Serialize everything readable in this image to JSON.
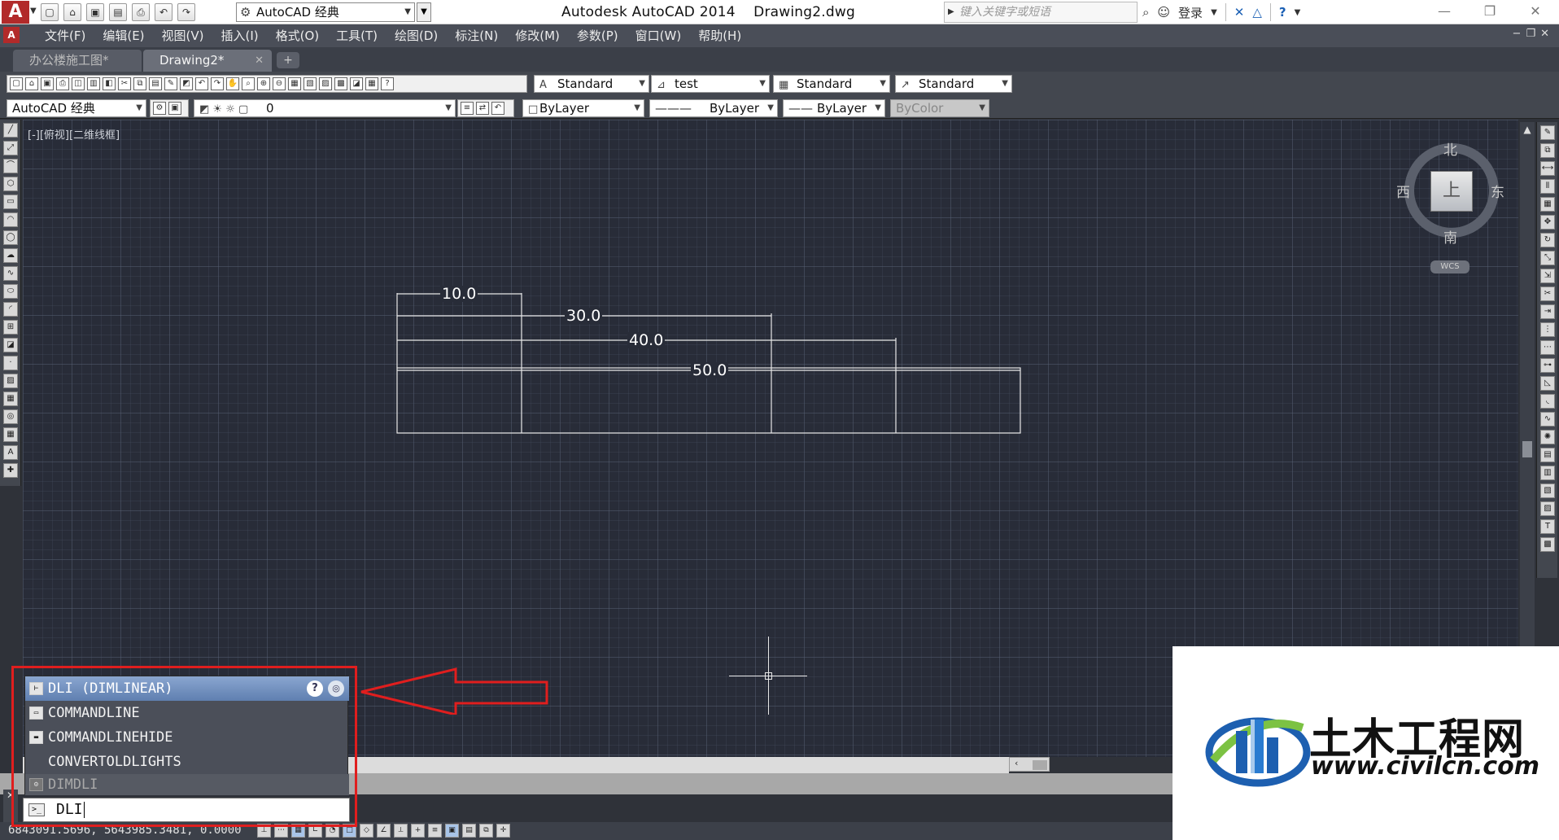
{
  "titlebar": {
    "workspace": "AutoCAD 经典",
    "window_title": "Autodesk AutoCAD 2014    Drawing2.dwg",
    "search_placeholder": "键入关键字或短语",
    "login_label": "登录"
  },
  "menu": [
    "文件(F)",
    "编辑(E)",
    "视图(V)",
    "插入(I)",
    "格式(O)",
    "工具(T)",
    "绘图(D)",
    "标注(N)",
    "修改(M)",
    "参数(P)",
    "窗口(W)",
    "帮助(H)"
  ],
  "tabs": [
    {
      "label": "办公楼施工图*",
      "active": false
    },
    {
      "label": "Drawing2*",
      "active": true
    }
  ],
  "styles_toolbar": {
    "text_style": "Standard",
    "dim_style": "test",
    "table_style": "Standard",
    "multileader_style": "Standard"
  },
  "layers_toolbar": {
    "workspace": "AutoCAD 经典",
    "layer": "0",
    "color": "ByLayer",
    "linetype": "ByLayer",
    "lineweight": "ByLayer",
    "plotstyle": "ByColor"
  },
  "viewport_label": "[-][俯视][二维线框]",
  "viewcube": {
    "north": "北",
    "south": "南",
    "east": "东",
    "west": "西",
    "face": "上",
    "wcs": "WCS"
  },
  "dimensions": [
    "10.0",
    "30.0",
    "40.0",
    "50.0"
  ],
  "autocomplete": {
    "items": [
      {
        "label": "DLI (DIMLINEAR)",
        "icon": "dimlinear-icon",
        "state": "selected"
      },
      {
        "label": "COMMANDLINE",
        "icon": "commandline-icon",
        "state": "normal"
      },
      {
        "label": "COMMANDLINEHIDE",
        "icon": "commandlinehide-icon",
        "state": "normal"
      },
      {
        "label": "CONVERTOLDLIGHTS",
        "icon": "",
        "state": "normal"
      },
      {
        "label": "DIMDLI",
        "icon": "settings-icon",
        "state": "dim"
      }
    ]
  },
  "command_input": {
    "value": "DLI"
  },
  "status": {
    "coordinates": "6843091.5696, 5643985.3481, 0.0000"
  },
  "watermark": {
    "title": "土木工程网",
    "url": "www.civilcn.com"
  },
  "colors": {
    "accent": "#e01e1e",
    "canvas": "#282c38",
    "selected": "#6f8dbd"
  }
}
